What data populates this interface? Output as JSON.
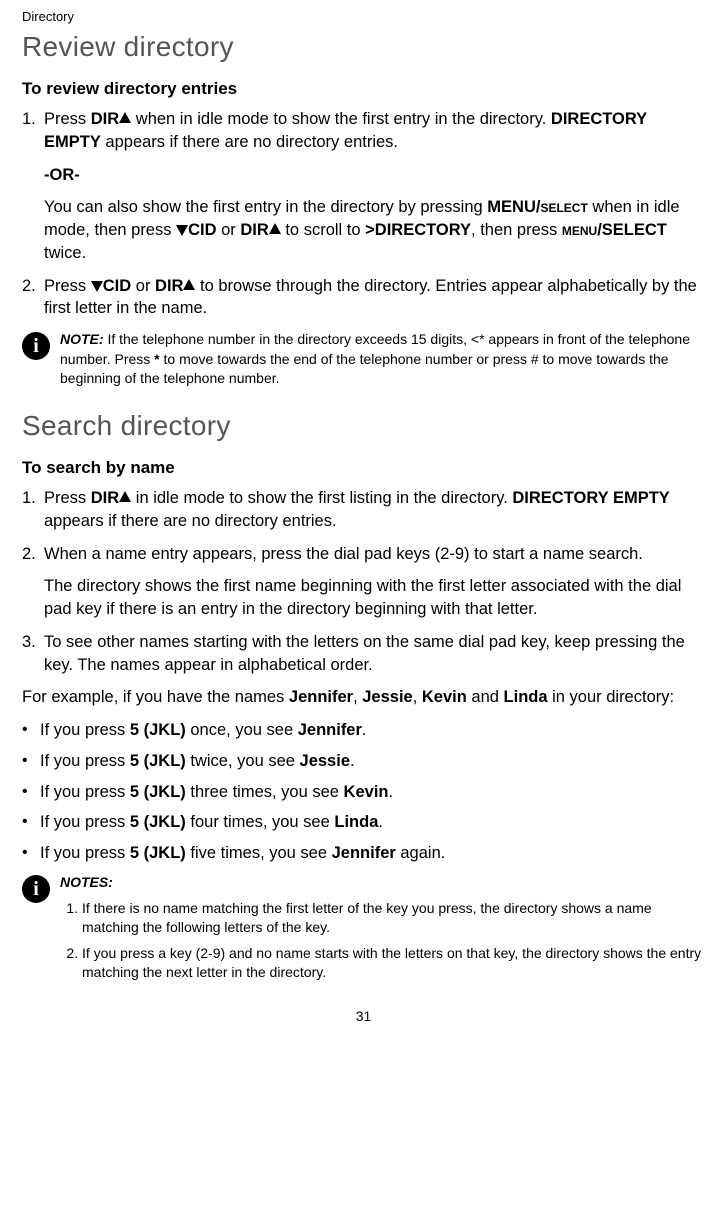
{
  "breadcrumb": "Directory",
  "section1": {
    "title": "Review directory",
    "subtitle": "To review directory entries",
    "step1_a": "Press ",
    "step1_b": "DIR",
    "step1_c": " when in idle mode to show the first entry in the directory. ",
    "step1_d": "DIRECTORY EMPTY",
    "step1_e": " appears if there are no directory entries.",
    "or": "-OR-",
    "alt_a": "You can also show the first entry in the directory by pressing ",
    "alt_b": "MENU/",
    "alt_b2": "select",
    "alt_c": " when in idle mode, then press ",
    "alt_d": "CID",
    "alt_e": " or ",
    "alt_f": "DIR",
    "alt_g": " to scroll to ",
    "alt_h": ">DIRECTORY",
    "alt_i": ", then press ",
    "alt_j": "menu",
    "alt_j2": "/SELECT",
    "alt_k": " twice.",
    "step2_a": "Press ",
    "step2_b": "CID",
    "step2_c": " or ",
    "step2_d": "DIR",
    "step2_e": " to browse through the directory. Entries appear alphabetically by the first letter in the name.",
    "note_label": "NOTE:",
    "note_text_a": " If the telephone number in the directory exceeds 15 digits, <* appears in front of the telephone number. Press ",
    "note_text_b": "*",
    "note_text_c": " to move towards the end of the telephone number or press # to move towards the beginning of the telephone number."
  },
  "section2": {
    "title": "Search directory",
    "subtitle": "To search by name",
    "step1_a": "Press ",
    "step1_b": "DIR",
    "step1_c": " in idle mode to show the first listing in the directory. ",
    "step1_d": "DIRECTORY EMPTY",
    "step1_e": " appears if there are no directory entries.",
    "step2": "When a name entry appears, press the dial pad keys (2-9) to start a name search.",
    "step2b": "The directory shows the first name beginning with the first letter associated with the dial pad key if there is an entry in the directory beginning with that letter.",
    "step3": "To see other names starting with the letters on the same dial pad key, keep pressing the key. The names appear in alphabetical order.",
    "example_a": "For example, if you have the names ",
    "ex_n1": "Jennifer",
    "ex_c1": ", ",
    "ex_n2": "Jessie",
    "ex_c2": ", ",
    "ex_n3": "Kevin",
    "ex_c3": " and ",
    "ex_n4": "Linda",
    "example_b": " in your directory:",
    "bullets": [
      {
        "a": "If you press ",
        "k": "5 (JKL)",
        "b": " once, you see ",
        "n": "Jennifer",
        "c": "."
      },
      {
        "a": "If you press ",
        "k": "5 (JKL)",
        "b": " twice, you see ",
        "n": "Jessie",
        "c": "."
      },
      {
        "a": "If you press ",
        "k": "5 (JKL)",
        "b": " three times, you see ",
        "n": "Kevin",
        "c": "."
      },
      {
        "a": "If you press ",
        "k": "5 (JKL)",
        "b": " four times, you see ",
        "n": "Linda",
        "c": "."
      },
      {
        "a": "If you press ",
        "k": "5 (JKL)",
        "b": " five times, you see ",
        "n": "Jennifer",
        "c": " again."
      }
    ],
    "notes_label": "NOTES:",
    "notes": [
      "If there is no name matching the first letter of the key you press, the directory shows a name matching the following letters of the key.",
      "If you press a key (2-9) and no name starts with the letters on that key, the directory shows the entry matching the next letter in the directory."
    ]
  },
  "page_number": "31"
}
